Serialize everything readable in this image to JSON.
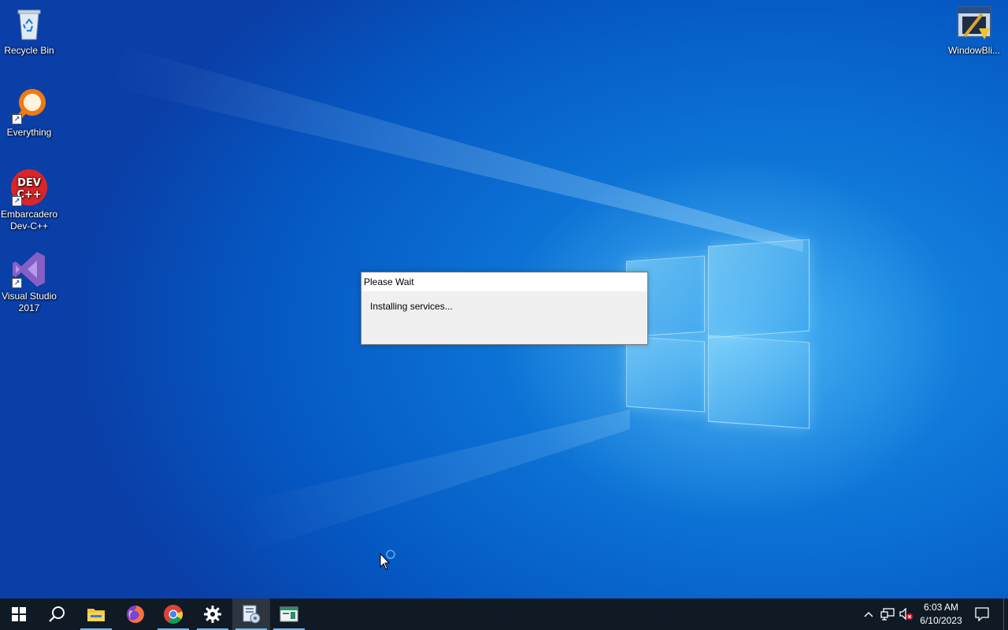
{
  "desktop": {
    "icons": [
      {
        "label": "Recycle Bin",
        "icon": "recycle-bin-icon"
      },
      {
        "label": "Everything",
        "icon": "everything-search-icon"
      },
      {
        "label_line1": "Embarcadero",
        "label_line2": "Dev-C++",
        "icon": "dev-cpp-icon",
        "badge": "DEV C++"
      },
      {
        "label_line1": "Visual Studio",
        "label_line2": "2017",
        "icon": "visual-studio-icon"
      },
      {
        "label": "WindowBli...",
        "icon": "windowblinds-icon"
      }
    ]
  },
  "dialog": {
    "title": "Please Wait",
    "message": "Installing services..."
  },
  "taskbar": {
    "buttons": [
      {
        "name": "start",
        "icon": "windows-start-icon"
      },
      {
        "name": "search",
        "icon": "search-icon"
      },
      {
        "name": "file-explorer",
        "icon": "folder-icon",
        "running": true
      },
      {
        "name": "firefox",
        "icon": "firefox-icon"
      },
      {
        "name": "chrome",
        "icon": "chrome-icon",
        "running": true
      },
      {
        "name": "settings",
        "icon": "gear-icon",
        "running": true
      },
      {
        "name": "installer",
        "icon": "installer-icon",
        "running": true,
        "active": true
      },
      {
        "name": "app-window",
        "icon": "window-app-icon",
        "running": true
      }
    ],
    "tray": {
      "chevron_icon": "chevron-up-icon",
      "network_icon": "network-icon",
      "volume_icon": "volume-muted-icon",
      "notification_icon": "notification-icon"
    },
    "clock": {
      "time": "6:03 AM",
      "date": "6/10/2023"
    }
  },
  "colors": {
    "desktop_blue": "#0a63c9",
    "taskbar": "#101a25",
    "dialog_bg": "#f0f0f0",
    "dialog_title_bg": "#ffffff"
  }
}
